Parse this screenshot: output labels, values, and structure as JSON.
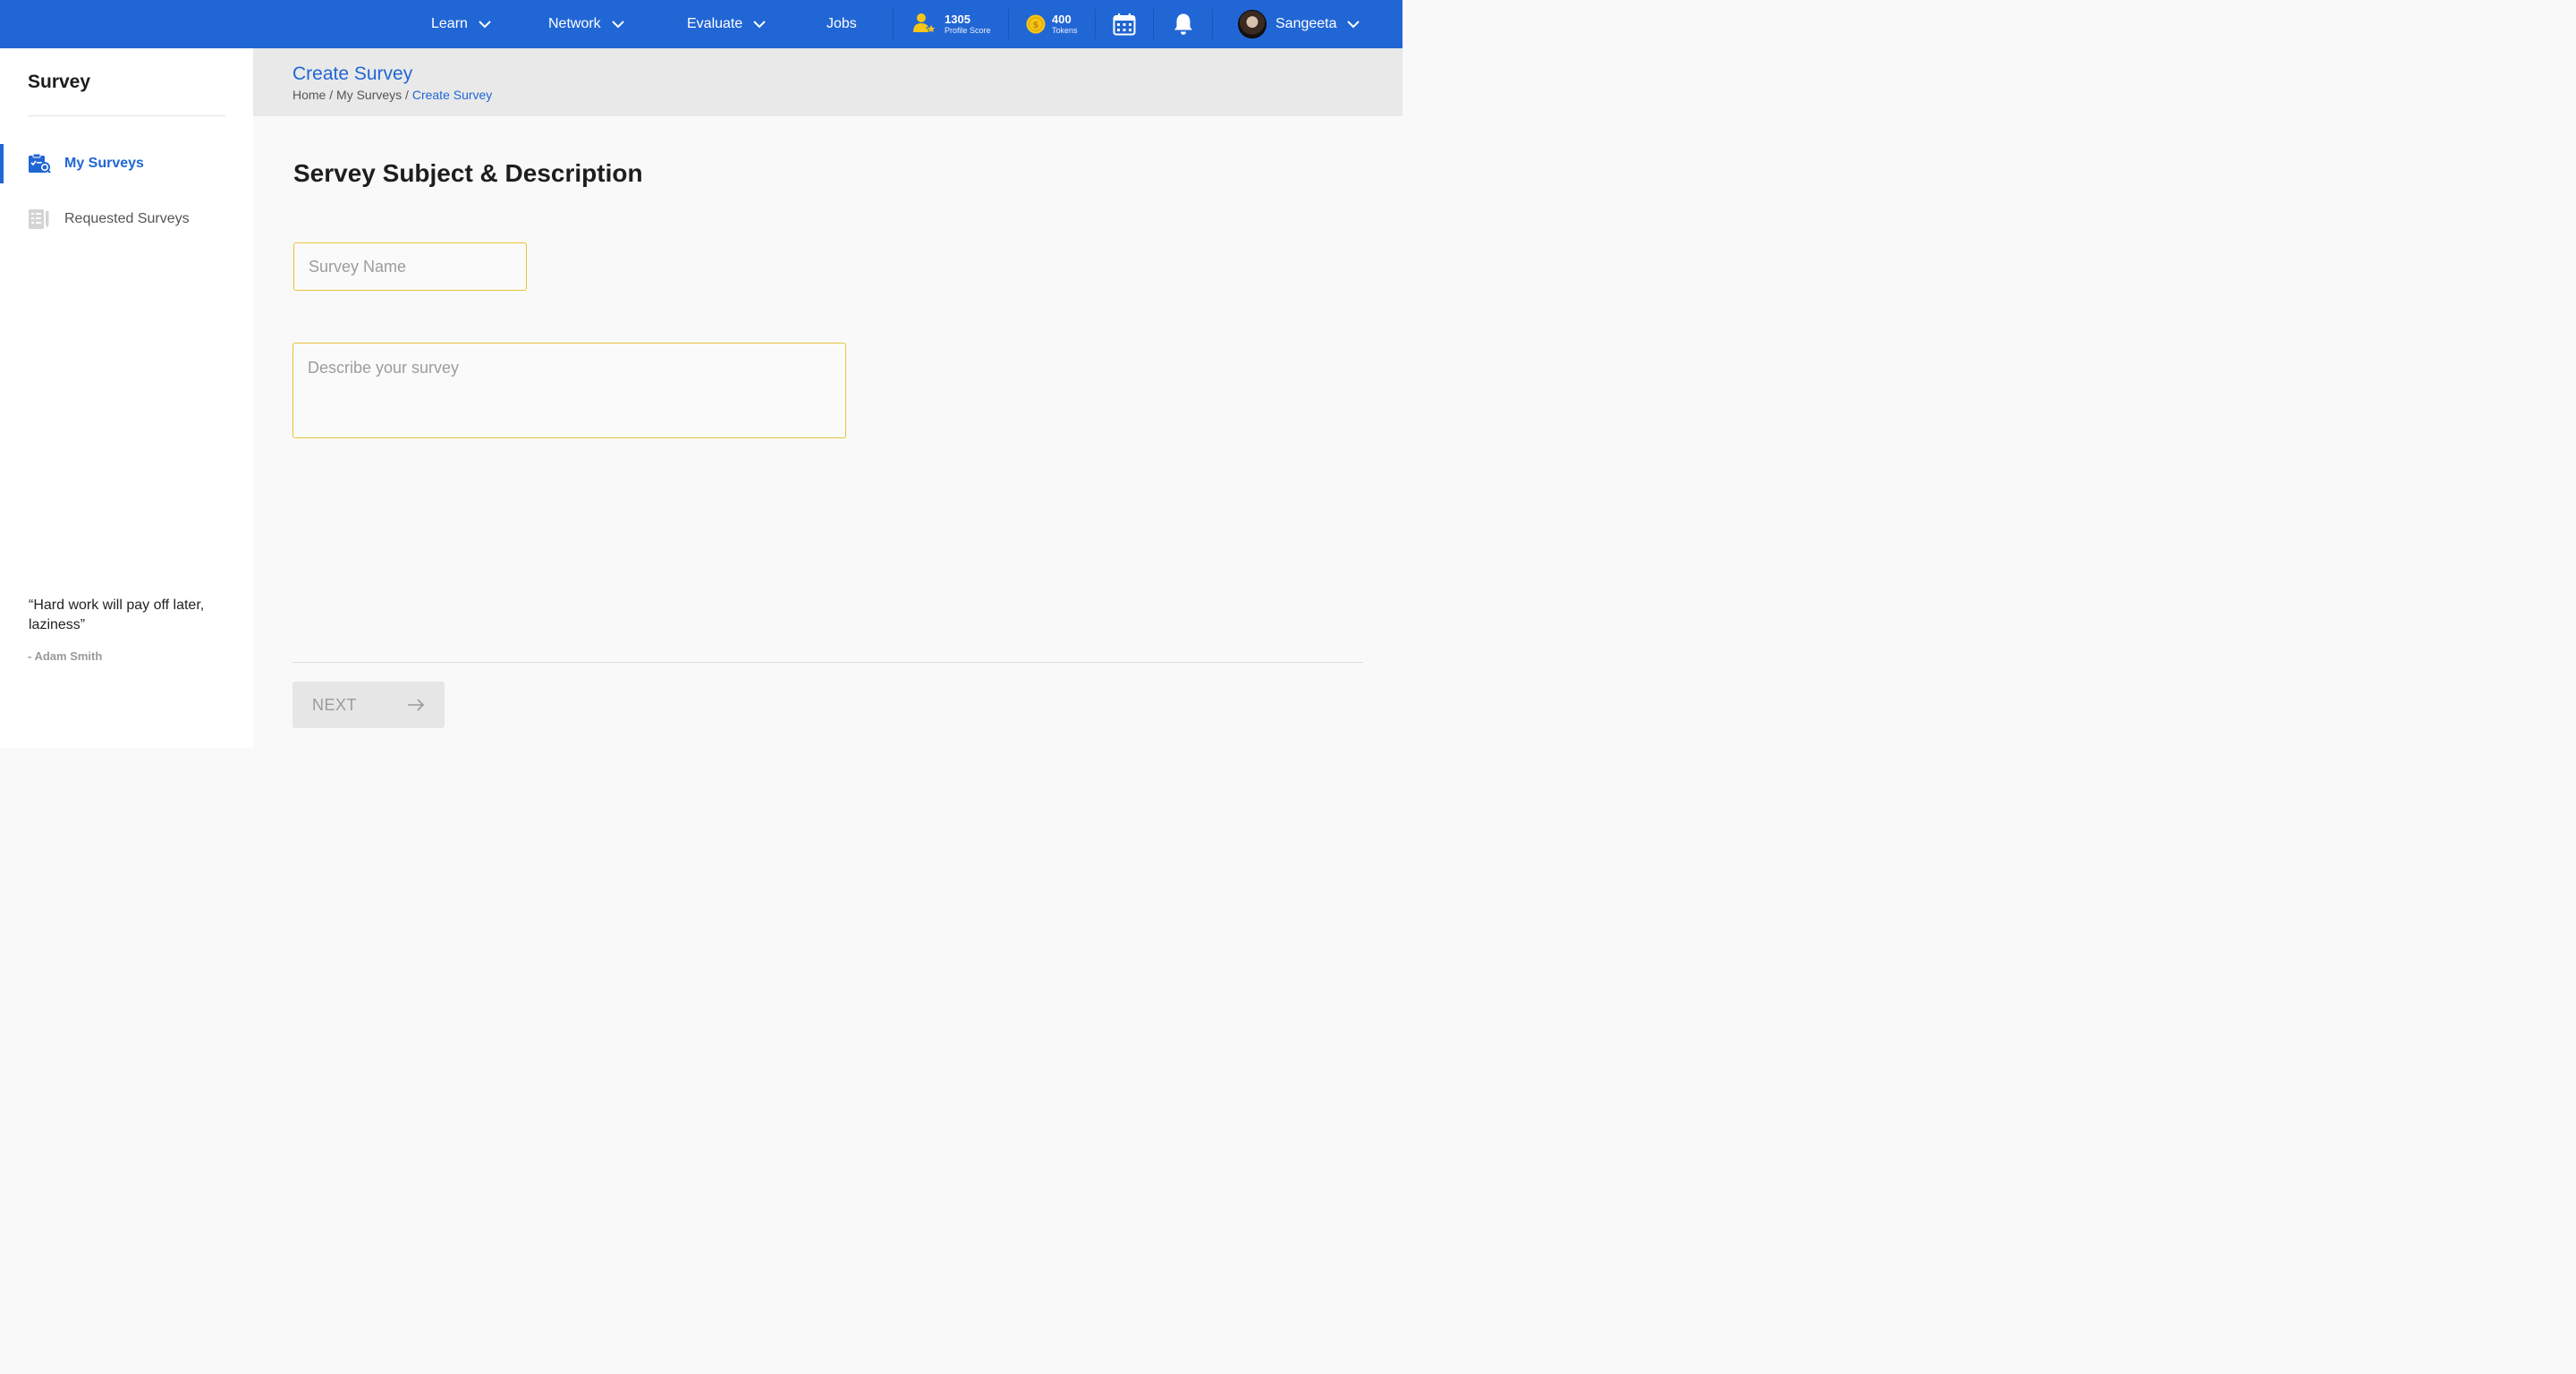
{
  "topnav": {
    "items": [
      {
        "label": "Learn",
        "has_dropdown": true
      },
      {
        "label": "Network",
        "has_dropdown": true
      },
      {
        "label": "Evaluate",
        "has_dropdown": true
      },
      {
        "label": "Jobs",
        "has_dropdown": false
      }
    ],
    "profile_score": {
      "value": "1305",
      "label": "Profile Score",
      "icon": "profile-score-icon"
    },
    "tokens": {
      "value": "400",
      "label": "Tokens",
      "icon": "coin-icon"
    },
    "calendar_icon": "calendar-icon",
    "notification_icon": "bell-icon",
    "user": {
      "name": "Sangeeta"
    }
  },
  "sidebar": {
    "title": "Survey",
    "items": [
      {
        "label": "My Surveys",
        "icon": "my-surveys-icon",
        "active": true
      },
      {
        "label": "Requested Surveys",
        "icon": "requested-surveys-icon",
        "active": false
      }
    ],
    "quote": {
      "text": "“Hard work will pay off later, laziness”",
      "author": "- Adam Smith"
    }
  },
  "header": {
    "title": "Create Survey",
    "breadcrumb": [
      "Home",
      "My Surveys",
      "Create Survey"
    ],
    "separator": " / "
  },
  "main": {
    "section_title": "Servey Subject & Description",
    "survey_name": {
      "value": "",
      "placeholder": "Survey Name"
    },
    "description": {
      "value": "",
      "placeholder": "Describe your survey"
    },
    "next_label": "NEXT"
  },
  "colors": {
    "primary": "#2166d5",
    "input_border": "#e8c43a",
    "accent_yellow": "#f5c518"
  }
}
